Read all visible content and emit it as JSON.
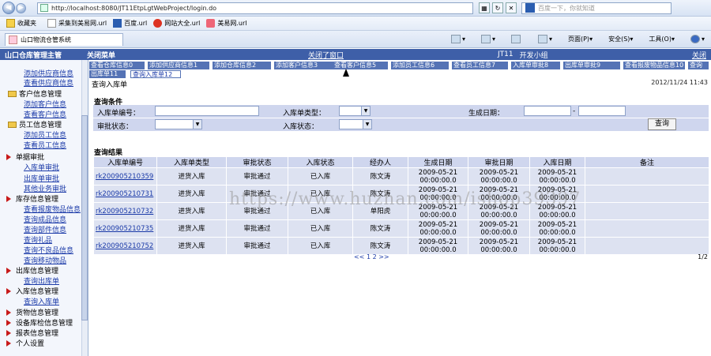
{
  "browser": {
    "url": "http://localhost:8080/JT11EtpLgtWebProject/login.do",
    "search_placeholder": "百度一下，你就知道",
    "favorites_label": "收藏夹",
    "favorites": [
      "采集到美易网.url",
      "百度.url",
      "网站大全.url",
      "美易网.url"
    ],
    "tab_title": "山口物流仓管系统",
    "commands": [
      "页面(P)",
      "安全(S)",
      "工具(O)"
    ]
  },
  "app": {
    "system_title": "山口仓库管理主管",
    "close_menu": "关闭菜单",
    "close_window": "关闭了窗口",
    "user_code": "JT11",
    "user_name": "开发小组",
    "close_link": "关闭"
  },
  "sidebar": {
    "items": [
      {
        "type": "link",
        "label": "添加供应商信息"
      },
      {
        "type": "link",
        "label": "查看供应商信息"
      },
      {
        "type": "folder",
        "label": "客户信息管理"
      },
      {
        "type": "link",
        "label": "添加客户信息"
      },
      {
        "type": "link",
        "label": "查看客户信息"
      },
      {
        "type": "folder",
        "label": "员工信息管理"
      },
      {
        "type": "link",
        "label": "添加员工信息"
      },
      {
        "type": "link",
        "label": "查看员工信息"
      },
      {
        "type": "arrow",
        "label": "单据审批"
      },
      {
        "type": "link",
        "label": "入库单审批"
      },
      {
        "type": "link",
        "label": "出库单审批"
      },
      {
        "type": "link",
        "label": "其他业务审批"
      },
      {
        "type": "arrow",
        "label": "库存信息管理"
      },
      {
        "type": "link",
        "label": "查看报废物品信息"
      },
      {
        "type": "link",
        "label": "查询成品信息"
      },
      {
        "type": "link",
        "label": "查询部件信息"
      },
      {
        "type": "link",
        "label": "查询礼品"
      },
      {
        "type": "link",
        "label": "查询不良品信息"
      },
      {
        "type": "link",
        "label": "查询移动物品"
      },
      {
        "type": "arrow",
        "label": "出库信息管理"
      },
      {
        "type": "link",
        "label": "查询出库单"
      },
      {
        "type": "arrow",
        "label": "入库信息管理"
      },
      {
        "type": "link",
        "label": "查询入库单"
      },
      {
        "type": "arrow",
        "label": "货物信息管理"
      },
      {
        "type": "arrow",
        "label": "设备库检信息管理"
      },
      {
        "type": "arrow",
        "label": "报表信息管理"
      },
      {
        "type": "arrow",
        "label": "个人设置"
      }
    ]
  },
  "shortcuts": [
    "查看仓库信息0",
    "添加供应商信息1",
    "添加仓库信息2",
    "添加客户信息3",
    "查看客户信息5",
    "添加员工信息6",
    "查看员工信息7",
    "入库单审批8",
    "出库单审批9",
    "查看报废物品信息10",
    "查询",
    "出库单11",
    "查询入库单12"
  ],
  "page": {
    "breadcrumb": "查询入库单",
    "datetime": "2012/11/24 11:43"
  },
  "query": {
    "title": "查询条件",
    "labels": {
      "code": "入库单编号：",
      "type": "入库单类型：",
      "date": "生成日期：",
      "date_sep": "-",
      "approval": "审批状态：",
      "status": "入库状态："
    },
    "button": "查询"
  },
  "results": {
    "title": "查询结果",
    "columns": [
      "入库单编号",
      "入库单类型",
      "审批状态",
      "入库状态",
      "经办人",
      "生成日期",
      "审批日期",
      "入库日期",
      "备注"
    ],
    "rows": [
      [
        "rk200905210359",
        "进货入库",
        "审批通过",
        "已入库",
        "陈文涛",
        "2009-05-21 00:00:00.0",
        "2009-05-21 00:00:00.0",
        "2009-05-21 00:00:00.0",
        ""
      ],
      [
        "rk200905210731",
        "进货入库",
        "审批通过",
        "已入库",
        "陈文涛",
        "2009-05-21 00:00:00.0",
        "2009-05-21 00:00:00.0",
        "2009-05-21 00:00:00.0",
        ""
      ],
      [
        "rk200905210732",
        "进货入库",
        "审批通过",
        "已入库",
        "单阳虎",
        "2009-05-21 00:00:00.0",
        "2009-05-21 00:00:00.0",
        "2009-05-21 00:00:00.0",
        ""
      ],
      [
        "rk200905210735",
        "进货入库",
        "审批通过",
        "已入库",
        "陈文涛",
        "2009-05-21 00:00:00.0",
        "2009-05-21 00:00:00.0",
        "2009-05-21 00:00:00.0",
        ""
      ],
      [
        "rk200905210752",
        "进货入库",
        "审批通过",
        "已入库",
        "陈文涛",
        "2009-05-21 00:00:00.0",
        "2009-05-21 00:00:00.0",
        "2009-05-21 00:00:00.0",
        ""
      ]
    ],
    "pager": "<< 1 2 >>",
    "page_count": "1/2"
  },
  "watermark": "https://www.huzhan.com/ishop39397"
}
